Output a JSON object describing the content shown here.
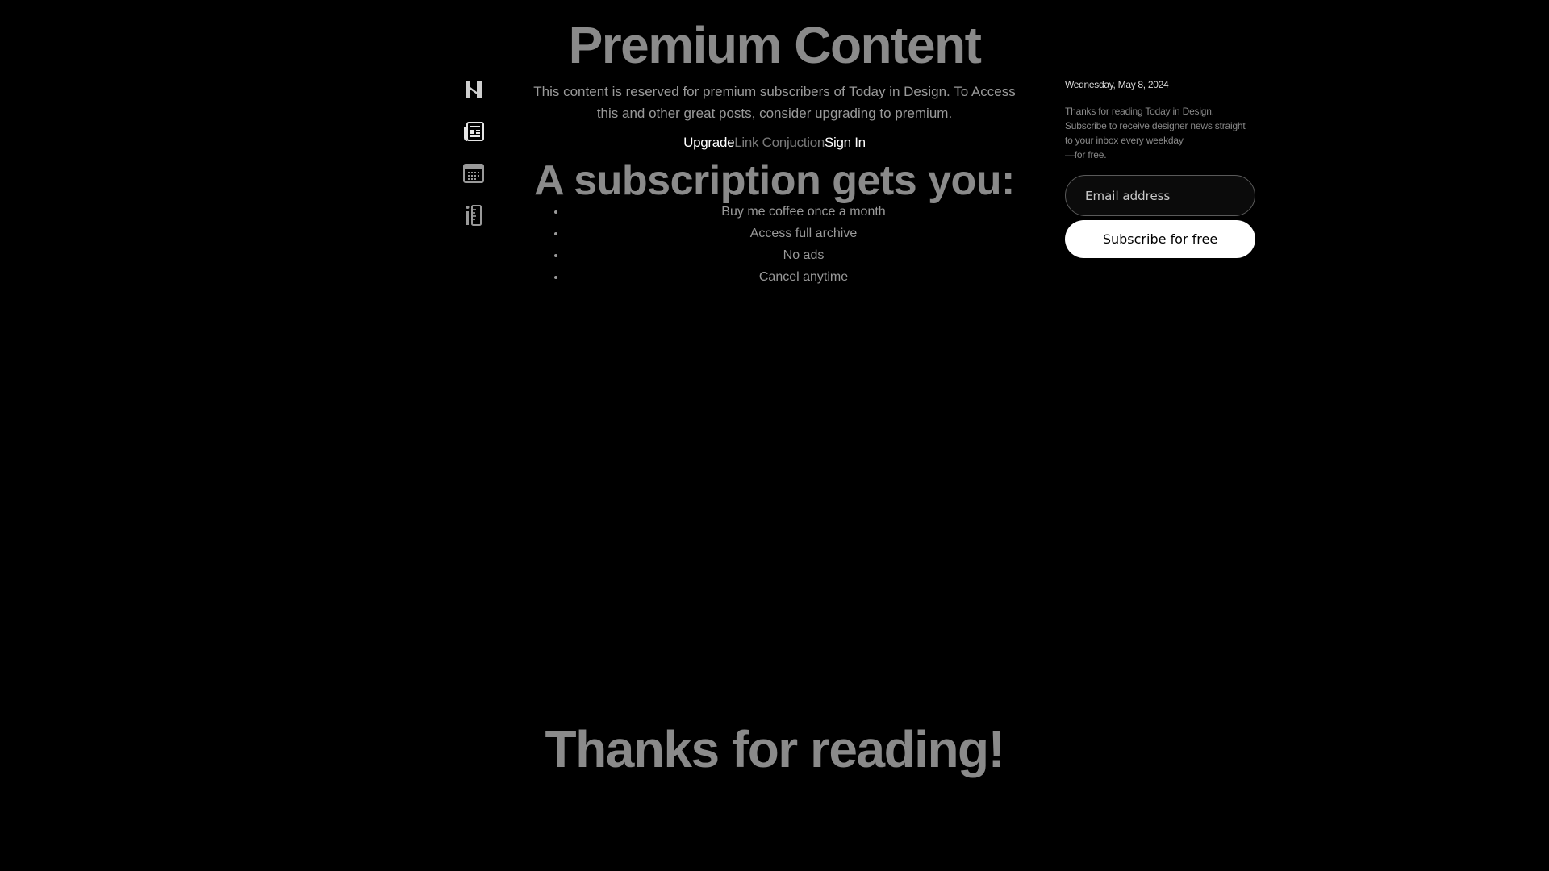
{
  "sidebar": {
    "items": [
      {
        "icon": "logo-h-icon"
      },
      {
        "icon": "newspaper-icon"
      },
      {
        "icon": "calendar-icon"
      },
      {
        "icon": "tools-icon"
      }
    ]
  },
  "main": {
    "title": "Premium Content",
    "intro": "This content is reserved for premium subscribers of Today in Design. To Access this and other great posts, consider upgrading to premium.",
    "links": {
      "upgrade": "Upgrade",
      "conjunction": "Link Conjuction",
      "sign_in": "Sign In"
    },
    "subscription_heading": "A subscription gets you:",
    "benefits": [
      "Buy me coffee once a month",
      "Access full archive",
      "No ads",
      "Cancel anytime"
    ],
    "thanks": "Thanks for reading!"
  },
  "right": {
    "date": "Wednesday, May 8, 2024",
    "blurb": {
      "line1": "Thanks for reading Today in Design.",
      "line2": "Subscribe to receive designer news straight to your inbox every weekday",
      "line3": "—for free."
    },
    "email_placeholder": "Email address",
    "subscribe_label": "Subscribe for free"
  },
  "colors": {
    "background": "#000000",
    "heading": "#8a8a8a",
    "body_text": "#9a9a9a",
    "button_bg": "#ffffff"
  }
}
